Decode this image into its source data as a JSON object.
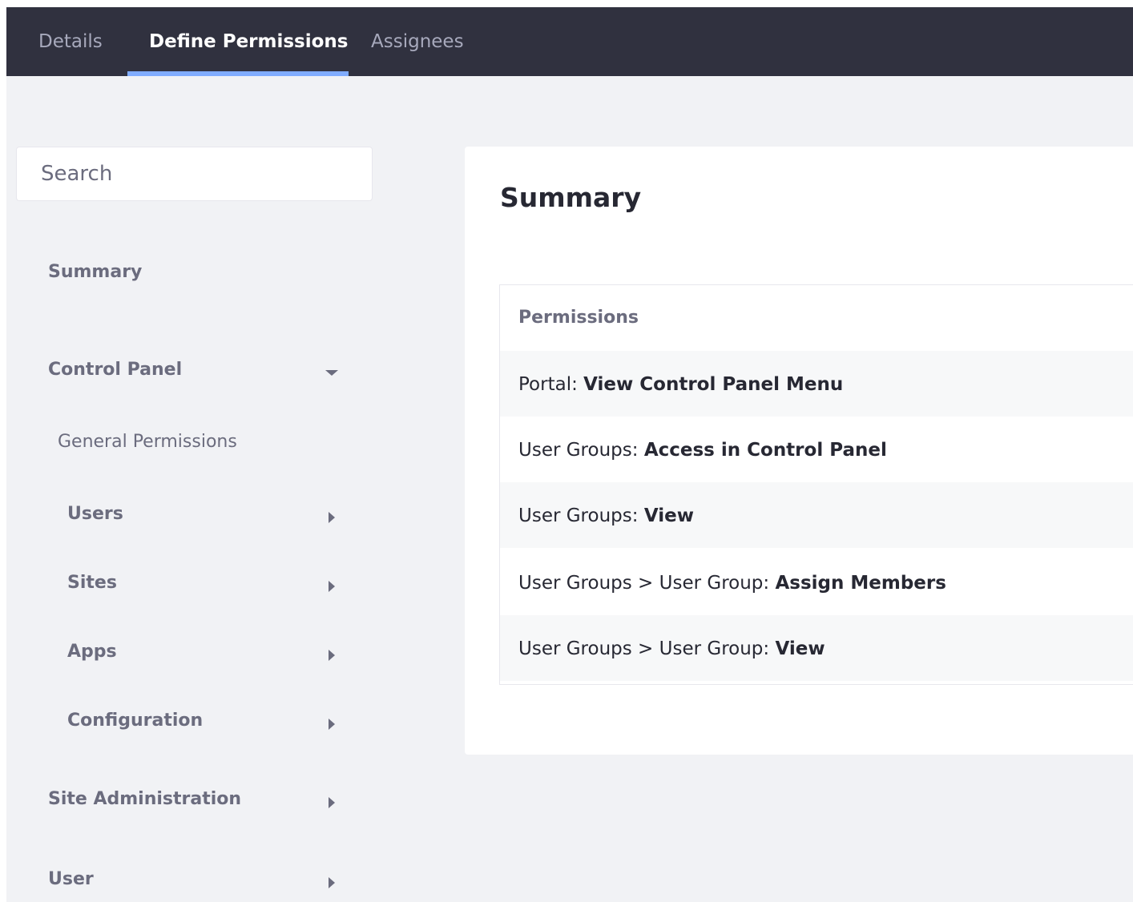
{
  "tabs": [
    {
      "label": "Details",
      "active": false
    },
    {
      "label": "Define Permissions",
      "active": true
    },
    {
      "label": "Assignees",
      "active": false
    }
  ],
  "search": {
    "placeholder": "Search"
  },
  "sidebar": {
    "summary": "Summary",
    "control_panel": "Control Panel",
    "general_permissions": "General Permissions",
    "users": "Users",
    "sites": "Sites",
    "apps": "Apps",
    "configuration": "Configuration",
    "site_administration": "Site Administration",
    "user": "User"
  },
  "summary": {
    "title": "Summary",
    "header": "Permissions",
    "rows": [
      {
        "prefix": "Portal: ",
        "permission": "View Control Panel Menu"
      },
      {
        "prefix": "User Groups: ",
        "permission": "Access in Control Panel"
      },
      {
        "prefix": "User Groups: ",
        "permission": "View"
      },
      {
        "prefix": "User Groups > User Group: ",
        "permission": "Assign Members"
      },
      {
        "prefix": "User Groups > User Group: ",
        "permission": "View"
      }
    ]
  },
  "colors": {
    "nav_bg": "#30313f",
    "accent": "#80acff",
    "page_bg": "#f1f2f5",
    "text_secondary": "#6b6c7e",
    "text_primary": "#272833"
  }
}
